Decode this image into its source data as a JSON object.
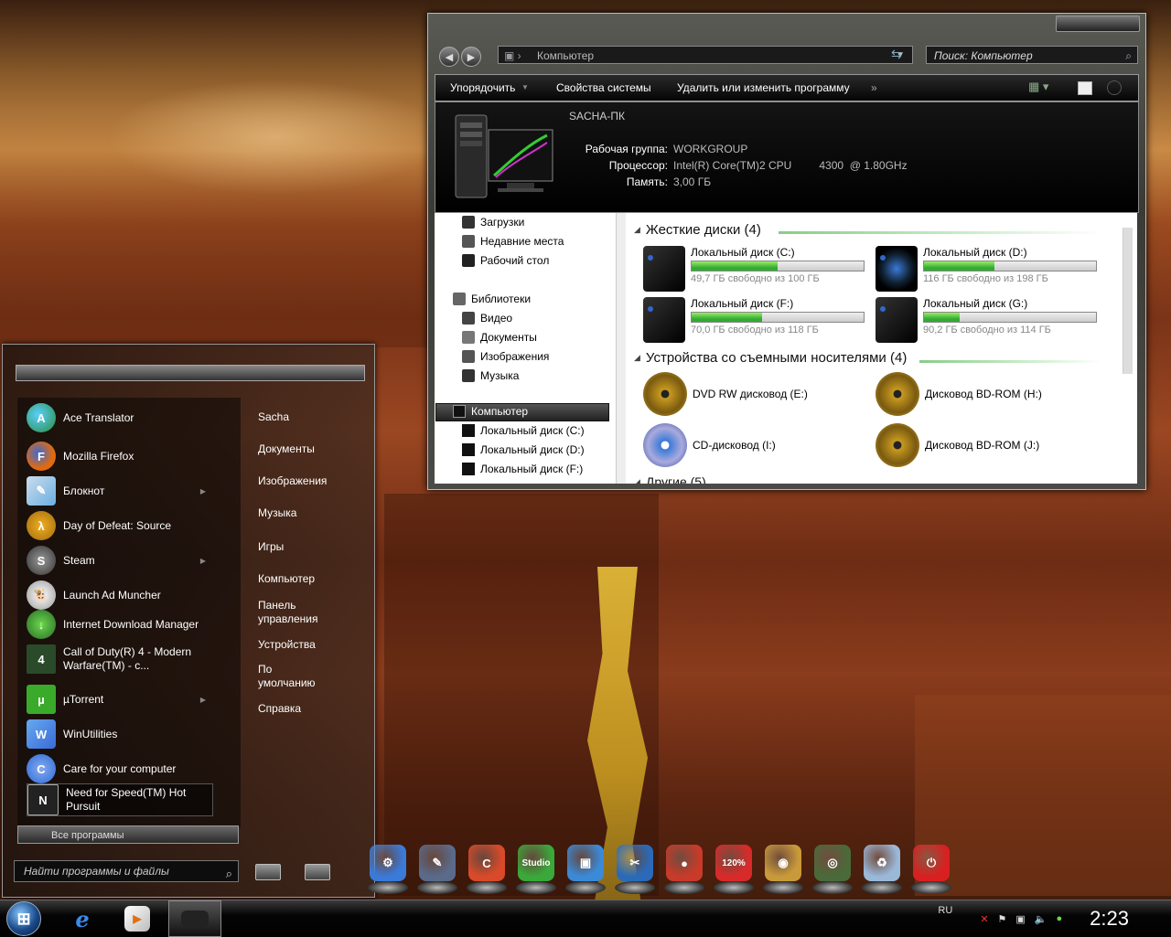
{
  "explorer": {
    "address": "Компьютер",
    "search_placeholder": "Поиск: Компьютер",
    "commands": [
      "Упорядочить",
      "Свойства системы",
      "Удалить или изменить программу",
      "»"
    ],
    "computer_name": "SACHA-ПК",
    "workgroup_label": "Рабочая группа:",
    "workgroup_value": "WORKGROUP",
    "cpu_label": "Процессор:",
    "cpu_value": "Intel(R) Core(TM)2 CPU         4300  @ 1.80GHz",
    "ram_label": "Память:",
    "ram_value": "3,00 ГБ",
    "nav": {
      "downloads": "Загрузки",
      "recent": "Недавние места",
      "desktop": "Рабочий стол",
      "libraries": "Библиотеки",
      "video": "Видео",
      "documents": "Документы",
      "pictures": "Изображения",
      "music": "Музыка",
      "computer": "Компьютер",
      "disk_c": "Локальный диск (C:)",
      "disk_d": "Локальный диск (D:)",
      "disk_f": "Локальный диск (F:)"
    },
    "hard_drives_title": "Жесткие диски (4)",
    "removable_title": "Устройства со съемными носителями (4)",
    "other_title": "Другие (5)",
    "drives": [
      {
        "name": "Локальный диск (C:)",
        "free": "49,7 ГБ свободно из 100 ГБ",
        "used_pct": 50
      },
      {
        "name": "Локальный диск (D:)",
        "free": "116 ГБ свободно из 198 ГБ",
        "used_pct": 41
      },
      {
        "name": "Локальный диск (F:)",
        "free": "70,0 ГБ свободно из 118 ГБ",
        "used_pct": 41
      },
      {
        "name": "Локальный диск (G:)",
        "free": "90,2 ГБ свободно из 114 ГБ",
        "used_pct": 21
      }
    ],
    "removable": [
      {
        "name": "DVD RW дисковод (E:)"
      },
      {
        "name": "Дисковод BD-ROM (H:)"
      },
      {
        "name": "CD-дисковод (I:)"
      },
      {
        "name": "Дисковод BD-ROM (J:)"
      }
    ]
  },
  "start_menu": {
    "programs": [
      {
        "label": "Ace Translator",
        "color": "#2a8a3a"
      },
      {
        "label": "Mozilla Firefox",
        "color": "#e06a10"
      },
      {
        "label": "Блокнот",
        "color": "#6aaee0"
      },
      {
        "label": "Day of Defeat: Source",
        "color": "#d89a10"
      },
      {
        "label": "Steam",
        "color": "#555555"
      },
      {
        "label": "Launch Ad Muncher",
        "color": "#cccccc"
      },
      {
        "label": "Internet Download Manager",
        "color": "#2a8a2a"
      },
      {
        "label": "Call of Duty(R) 4 - Modern Warfare(TM) - c...",
        "color": "#2a5a2a"
      },
      {
        "label": "µTorrent",
        "color": "#3aaa2a"
      },
      {
        "label": "WinUtilities",
        "color": "#3a6ad8"
      },
      {
        "label": "Care for your computer",
        "color": "#2a6ad8"
      },
      {
        "label": "Need for Speed(TM) Hot Pursuit",
        "color": "#222222"
      }
    ],
    "user": "Sacha",
    "places": [
      "Документы",
      "Изображения",
      "Музыка",
      "Игры",
      "Компьютер",
      "Панель управления",
      "Устройства",
      "По умолчанию",
      "Справка"
    ],
    "all_programs": "Все программы",
    "search_placeholder": "Найти программы и файлы"
  },
  "dock": {
    "items": [
      {
        "name": "tools-dock-icon",
        "color": "#3a7ad8",
        "glyph": "⚙"
      },
      {
        "name": "design-dock-icon",
        "color": "#5a6a8a",
        "glyph": "✎"
      },
      {
        "name": "ccleaner-dock-icon",
        "color": "#d84a2a",
        "glyph": "C"
      },
      {
        "name": "studio-dock-icon",
        "color": "#3aa83a",
        "glyph": "Studio"
      },
      {
        "name": "photo-dock-icon",
        "color": "#3a8ad8",
        "glyph": "▣"
      },
      {
        "name": "utility-dock-icon",
        "color": "#2a6ab8",
        "glyph": "✂"
      },
      {
        "name": "joystick-dock-icon",
        "color": "#c83a2a",
        "glyph": "●"
      },
      {
        "name": "alcohol-dock-icon",
        "color": "#d82a2a",
        "glyph": "120%"
      },
      {
        "name": "disc-burner-dock-icon",
        "color": "#c89a3a",
        "glyph": "◉"
      },
      {
        "name": "network-dock-icon",
        "color": "#4a6a3a",
        "glyph": "◎"
      },
      {
        "name": "recycle-bin-dock-icon",
        "color": "#9ab8d8",
        "glyph": "♻"
      },
      {
        "name": "power-dock-icon",
        "color": "#d82020",
        "glyph": "⏻"
      }
    ]
  },
  "taskbar": {
    "language": "RU",
    "clock": "2:23"
  }
}
